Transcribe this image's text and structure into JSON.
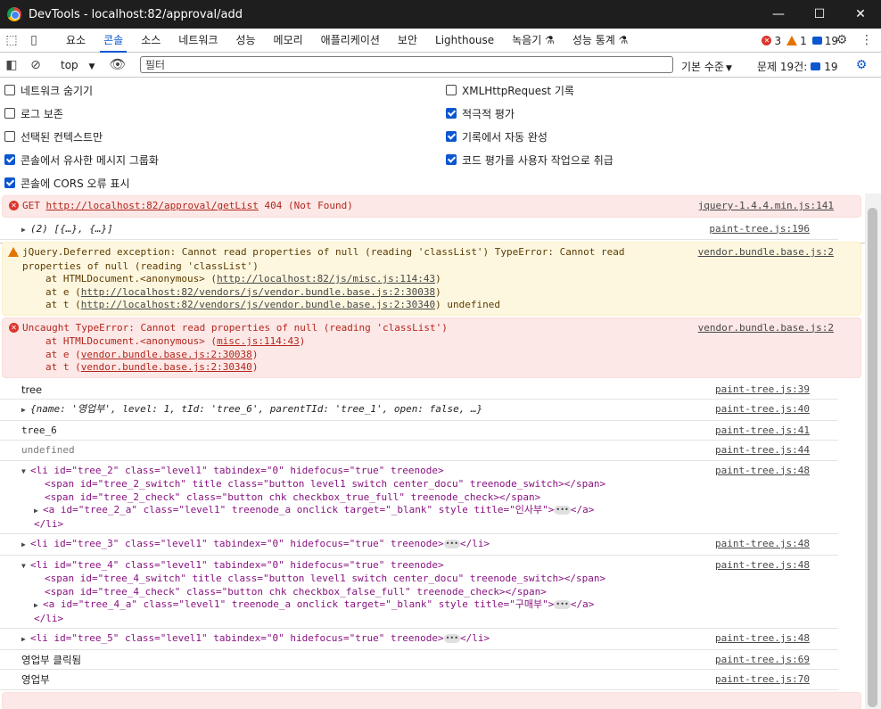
{
  "window": {
    "title": "DevTools - localhost:82/approval/add"
  },
  "tabs": [
    "요소",
    "콘솔",
    "소스",
    "네트워크",
    "성능",
    "메모리",
    "애플리케이션",
    "보안",
    "Lighthouse",
    "녹음기 ⚗",
    "성능 통계 ⚗"
  ],
  "badges": {
    "errors": "3",
    "warnings": "1",
    "messages": "19"
  },
  "toolbar": {
    "context": "top",
    "filter_placeholder": "필터",
    "level": "기본 수준",
    "issues_label": "문제 19건:",
    "issues_count": "19"
  },
  "settings": {
    "left": [
      {
        "label": "네트워크 숨기기",
        "checked": false
      },
      {
        "label": "로그 보존",
        "checked": false
      },
      {
        "label": "선택된 컨텍스트만",
        "checked": false
      },
      {
        "label": "콘솔에서 유사한 메시지 그룹화",
        "checked": true
      },
      {
        "label": "콘솔에 CORS 오류 표시",
        "checked": true
      }
    ],
    "right": [
      {
        "label": "XMLHttpRequest 기록",
        "checked": false
      },
      {
        "label": "적극적 평가",
        "checked": true
      },
      {
        "label": "기록에서 자동 완성",
        "checked": true
      },
      {
        "label": "코드 평가를 사용자 작업으로 취급",
        "checked": true
      }
    ]
  },
  "console": {
    "get_error": {
      "method": "GET",
      "url": "http://localhost:82/approval/getList",
      "status": "404 (Not Found)",
      "src": "jquery-1.4.4.min.js:141"
    },
    "arr": {
      "text": "(2) [{…}, {…}]",
      "src": "paint-tree.js:196"
    },
    "deferred": {
      "line1": "jQuery.Deferred exception: Cannot read properties of null (reading 'classList') TypeError: Cannot read",
      "line2": "properties of null (reading 'classList')",
      "at1_pre": "at HTMLDocument.<anonymous> (",
      "at1_url": "http://localhost:82/js/misc.js:114:43",
      "at1_post": ")",
      "at2_pre": "at e (",
      "at2_url": "http://localhost:82/vendors/js/vendor.bundle.base.js:2:30038",
      "at2_post": ")",
      "at3_pre": "at t (",
      "at3_url": "http://localhost:82/vendors/js/vendor.bundle.base.js:2:30340",
      "at3_post": ") undefined",
      "src": "vendor.bundle.base.js:2"
    },
    "uncaught": {
      "line1": "Uncaught TypeError: Cannot read properties of null (reading 'classList')",
      "at1_pre": "at HTMLDocument.<anonymous> (",
      "at1_url": "misc.js:114:43",
      "at1_post": ")",
      "at2_pre": "at e (",
      "at2_url": "vendor.bundle.base.js:2:30038",
      "at2_post": ")",
      "at3_pre": "at t (",
      "at3_url": "vendor.bundle.base.js:2:30340",
      "at3_post": ")",
      "src": "vendor.bundle.base.js:2"
    },
    "tree": {
      "text": "tree",
      "src": "paint-tree.js:39"
    },
    "obj": {
      "text": "{name: '영업부', level: 1, tId: 'tree_6', parentTId: 'tree_1', open: false, …}",
      "src": "paint-tree.js:40"
    },
    "tree6": {
      "text": "tree_6",
      "src": "paint-tree.js:41"
    },
    "undef": {
      "text": "undefined",
      "src": "paint-tree.js:44"
    },
    "li2": {
      "open": "<li id=\"tree_2\" class=\"level1\" tabindex=\"0\" hidefocus=\"true\" treenode>",
      "span1": "<span id=\"tree_2_switch\" title class=\"button level1 switch center_docu\" treenode_switch></span>",
      "span2": "<span id=\"tree_2_check\" class=\"button chk checkbox_true_full\" treenode_check></span>",
      "a": "<a id=\"tree_2_a\" class=\"level1\" treenode_a onclick target=\"_blank\" style title=\"인사부\">",
      "a_close": "</a>",
      "close": "</li>",
      "src": "paint-tree.js:48"
    },
    "li3": {
      "text": "<li id=\"tree_3\" class=\"level1\" tabindex=\"0\" hidefocus=\"true\" treenode>",
      "close": "</li>",
      "src": "paint-tree.js:48"
    },
    "li4": {
      "open": "<li id=\"tree_4\" class=\"level1\" tabindex=\"0\" hidefocus=\"true\" treenode>",
      "span1": "<span id=\"tree_4_switch\" title class=\"button level1 switch center_docu\" treenode_switch></span>",
      "span2": "<span id=\"tree_4_check\" class=\"button chk checkbox_false_full\" treenode_check></span>",
      "a": "<a id=\"tree_4_a\" class=\"level1\" treenode_a onclick target=\"_blank\" style title=\"구매부\">",
      "a_close": "</a>",
      "close": "</li>",
      "src": "paint-tree.js:48"
    },
    "li5": {
      "text": "<li id=\"tree_5\" class=\"level1\" tabindex=\"0\" hidefocus=\"true\" treenode>",
      "close": "</li>",
      "src": "paint-tree.js:48"
    },
    "click": {
      "text": "영업부 클릭됨",
      "src": "paint-tree.js:69"
    },
    "dept": {
      "text": "영업부",
      "src": "paint-tree.js:70"
    }
  }
}
